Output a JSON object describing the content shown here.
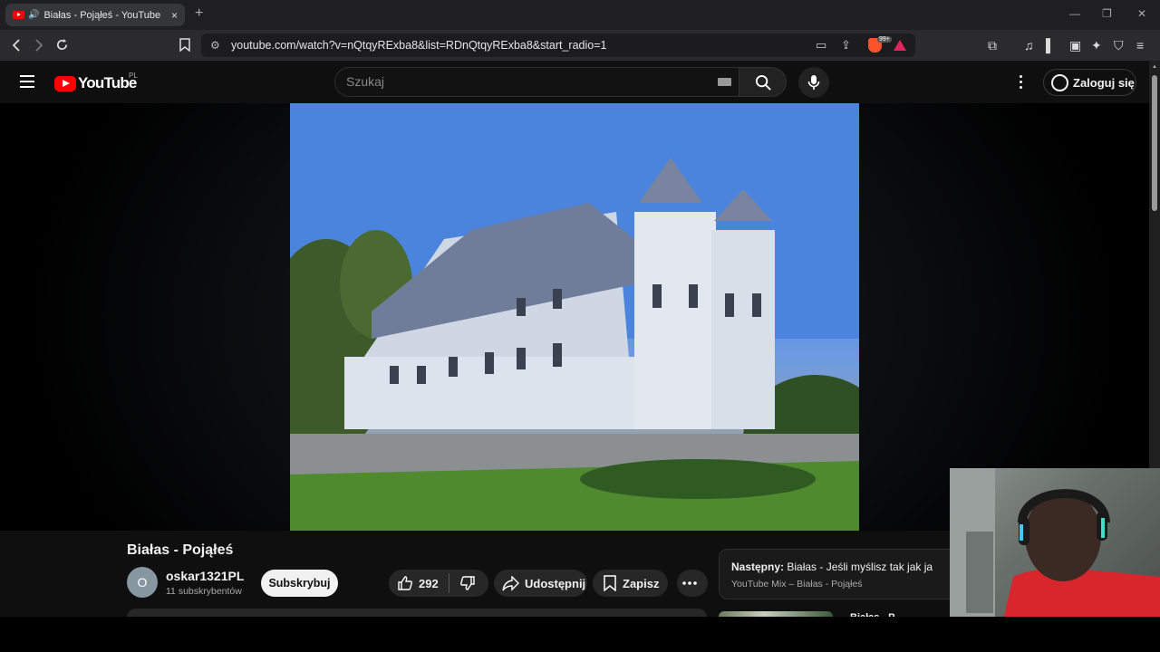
{
  "browser": {
    "tab": {
      "title": "Białas - Pojąłeś - YouTube",
      "close": "×"
    },
    "new_tab": "+",
    "window_controls": {
      "minimize": "—",
      "restore": "❐",
      "close": "✕"
    },
    "url": "youtube.com/watch?v=nQtqyRExba8&list=RDnQtqyRExba8&start_radio=1",
    "shield_badge": "99+"
  },
  "youtube": {
    "logo_text": "YouTube",
    "region": "PL",
    "search_placeholder": "Szukaj",
    "signin_label": "Zaloguj się"
  },
  "video": {
    "title": "Białas - Pojąłeś",
    "channel": {
      "avatar_letter": "O",
      "name": "oskar1321PL",
      "subscribers": "11 subskrybentów",
      "subscribe_label": "Subskrybuj"
    },
    "actions": {
      "likes": "292",
      "share_label": "Udostępnij",
      "save_label": "Zapisz"
    }
  },
  "up_next": {
    "label": "Następny:",
    "title": "Białas - Jeśli myślisz tak jak ja",
    "playlist": "YouTube Mix – Białas - Pojąłeś",
    "peek_title": "Białas - P"
  },
  "colors": {
    "youtube_red": "#ff0000",
    "background": "#0f0f0f",
    "pill": "#272727"
  }
}
